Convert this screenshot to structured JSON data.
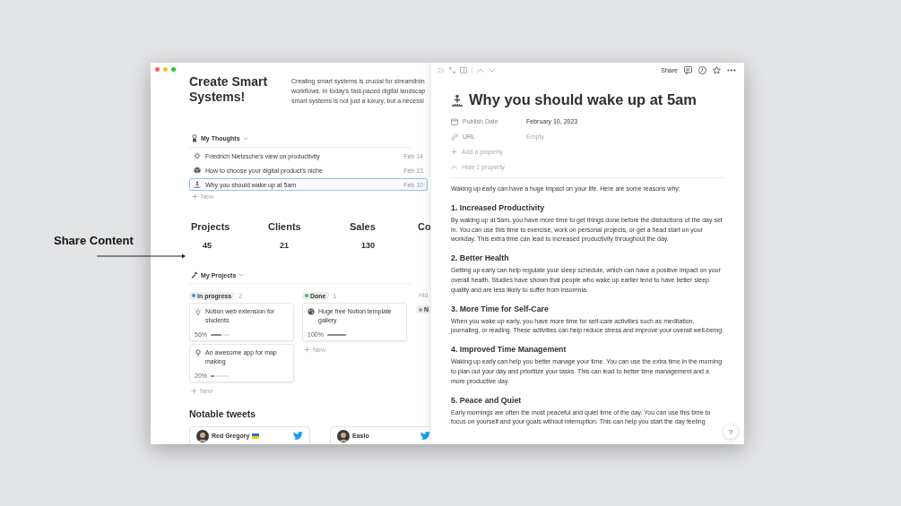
{
  "annotation": {
    "label": "Share Content"
  },
  "left_page": {
    "title": "Create Smart Systems!",
    "description": [
      "Creating smart systems is crucial for streamlinin",
      "workflows. In today's fast-paced digital landscap",
      "smart systems is not just a luxury, but a necessi"
    ],
    "thoughts": {
      "heading": "My Thoughts",
      "items": [
        {
          "title": "Friedrich Nietzsche's view on productivity",
          "date": "Feb 14",
          "selected": false
        },
        {
          "title": "How to choose your digital product's niche",
          "date": "Feb 13",
          "selected": false
        },
        {
          "title": "Why you should wake up at 5am",
          "date": "Feb 10",
          "selected": true
        }
      ],
      "new_label": "New"
    },
    "stats": [
      {
        "label": "Projects",
        "value": "45"
      },
      {
        "label": "Clients",
        "value": "21"
      },
      {
        "label": "Sales",
        "value": "130"
      },
      {
        "label": "Co"
      }
    ],
    "projects": {
      "heading": "My Projects",
      "groups": [
        {
          "name": "In progress",
          "count": "2",
          "color": "#4a90d9",
          "cards": [
            {
              "title": "Notion web extension for students",
              "progress": "56%",
              "level": 0.56
            },
            {
              "title": "An awesome app for map making",
              "progress": "20%",
              "level": 0.2
            }
          ],
          "new_label": "New"
        },
        {
          "name": "Done",
          "count": "1",
          "color": "#4caf7d",
          "cards": [
            {
              "title": "Huge free Notion template gallery",
              "progress": "100%",
              "level": 1
            }
          ],
          "new_label": "New"
        }
      ],
      "hidden_label": "Hid",
      "hidden_groups": [
        {
          "name": "N",
          "color": "#9b9a97"
        }
      ]
    },
    "tweets": {
      "heading": "Notable tweets",
      "items": [
        {
          "author": "Red Gregory",
          "flag": true
        },
        {
          "author": "Easlo",
          "flag": false
        }
      ]
    }
  },
  "side_peek": {
    "share": "Share",
    "title": "Why you should wake up at 5am",
    "properties": [
      {
        "kind": "date",
        "name": "Publish Date",
        "value": "February 10, 2023",
        "empty": false
      },
      {
        "kind": "url",
        "name": "URL",
        "value": "Empty",
        "empty": true
      }
    ],
    "add_property": "Add a property",
    "hide_property": "Hide 1 property",
    "intro": "Waking up early can have a huge impact on your life. Here are some reasons why:",
    "sections": [
      {
        "heading": "1. Increased Productivity",
        "body": "By waking up at 5am, you have more time to get things done before the distractions of the day set in. You can use this time to exercise, work on personal projects, or get a head start on your workday. This extra time can lead to increased productivity throughout the day."
      },
      {
        "heading": "2. Better Health",
        "body": "Getting up early can help regulate your sleep schedule, which can have a positive impact on your overall health. Studies have shown that people who wake up earlier tend to have better sleep quality and are less likely to suffer from insomnia."
      },
      {
        "heading": "3. More Time for Self-Care",
        "body": "When you wake up early, you have more time for self-care activities such as meditation, journaling, or reading. These activities can help reduce stress and improve your overall well-being."
      },
      {
        "heading": "4. Improved Time Management",
        "body": "Waking up early can help you better manage your time. You can use the extra time in the morning to plan out your day and prioritize your tasks. This can lead to better time management and a more productive day."
      },
      {
        "heading": "5. Peace and Quiet",
        "body": "Early mornings are often the most peaceful and quiet time of the day. You can use this time to focus on yourself and your goals without interruption. This can help you start the day feeling"
      }
    ],
    "help": "?"
  }
}
